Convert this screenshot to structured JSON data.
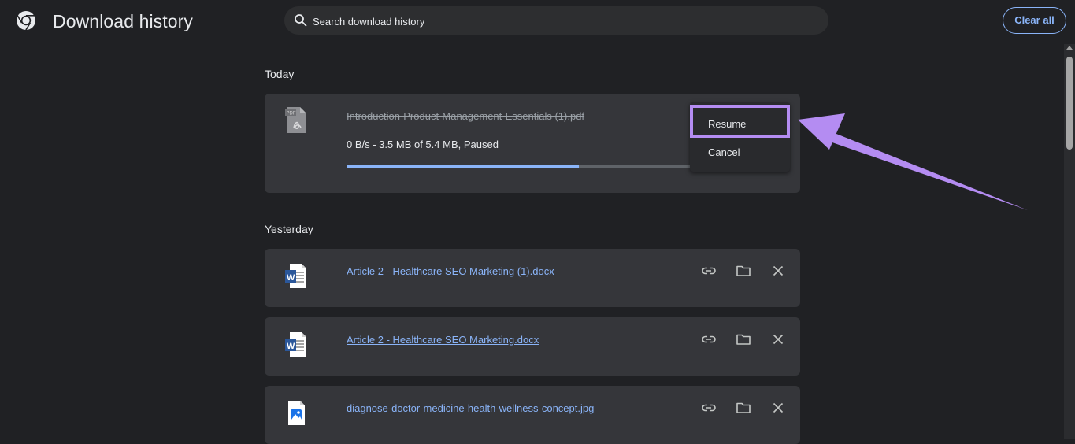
{
  "header": {
    "title": "Download history",
    "search_placeholder": "Search download history",
    "clear_all_label": "Clear all"
  },
  "sections": [
    {
      "label": "Today"
    },
    {
      "label": "Yesterday"
    }
  ],
  "paused_download": {
    "file_name": "Introduction-Product-Management-Essentials (1).pdf",
    "file_type_icon": "pdf-file-icon",
    "status": "0 B/s - 3.5 MB of 5.4 MB, Paused",
    "progress": 0.648
  },
  "context_menu": {
    "items": [
      {
        "label": "Resume"
      },
      {
        "label": "Cancel"
      }
    ],
    "highlight_color": "#b48cf2"
  },
  "downloads": [
    {
      "file_name": "Article 2 - Healthcare SEO Marketing (1).docx",
      "file_type_icon": "word-file-icon"
    },
    {
      "file_name": "Article 2 - Healthcare SEO Marketing.docx",
      "file_type_icon": "word-file-icon"
    },
    {
      "file_name": "diagnose-doctor-medicine-health-wellness-concept.jpg",
      "file_type_icon": "image-file-icon"
    }
  ],
  "row_actions": [
    "copy-link-icon",
    "folder-icon",
    "close-icon"
  ],
  "colors": {
    "background": "#202124",
    "card": "#35363a",
    "link": "#8ab4f8",
    "progress": "#8ab4f8",
    "annotation": "#b48cf2"
  }
}
